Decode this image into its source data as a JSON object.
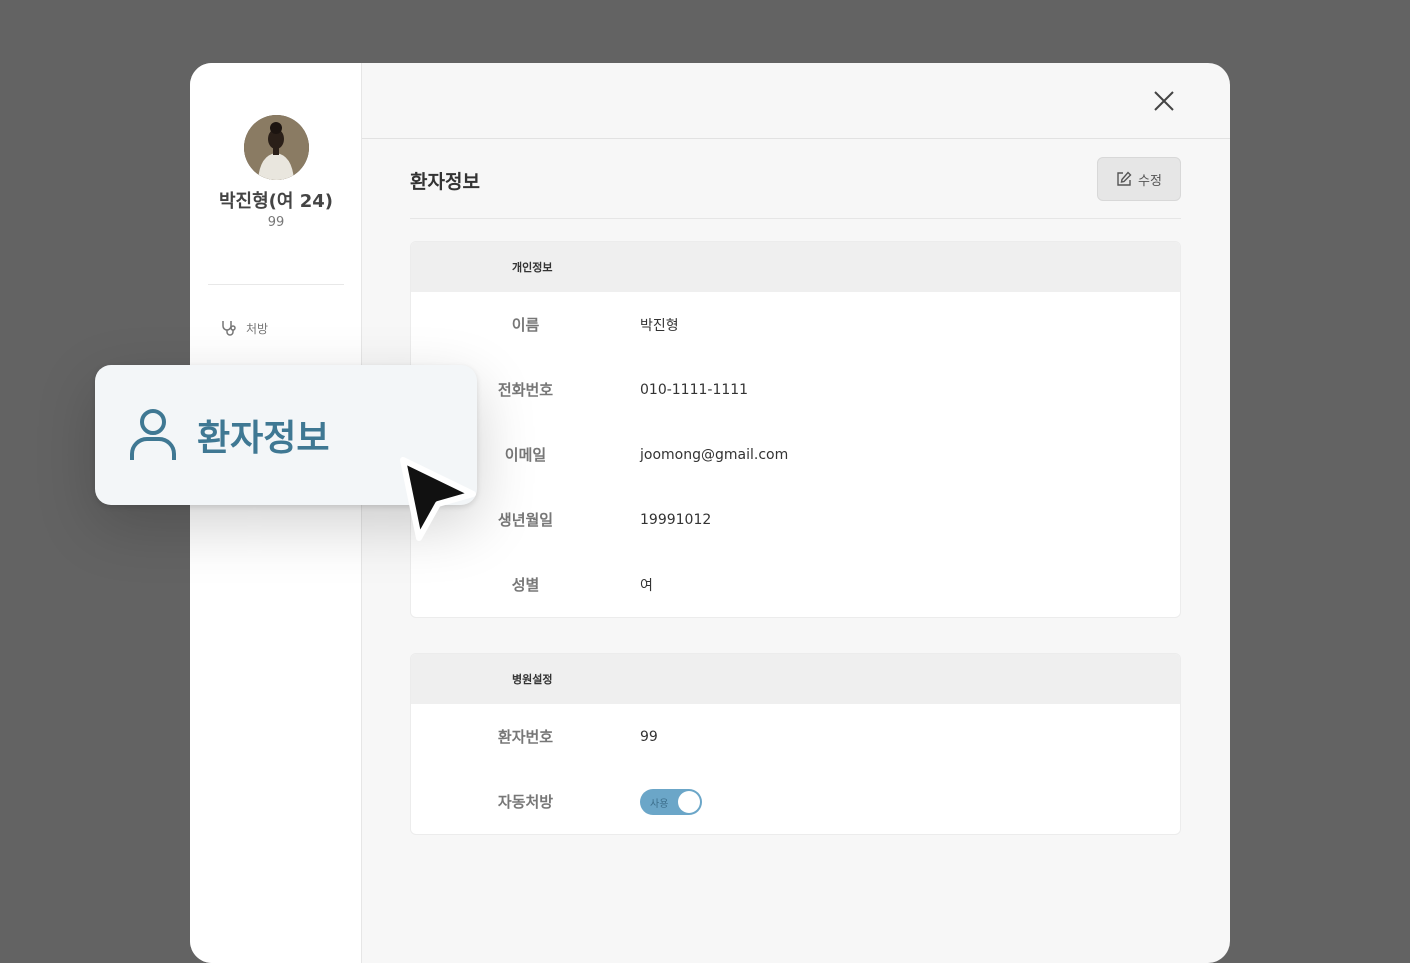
{
  "sidebar": {
    "patient_name": "박진형(여 24)",
    "patient_number": "99",
    "items": [
      {
        "label": "처방",
        "icon": "stethoscope-icon"
      }
    ]
  },
  "header": {
    "close_icon": "close-icon"
  },
  "main": {
    "title": "환자정보",
    "edit_label": "수정",
    "edit_icon": "edit-icon"
  },
  "personal_info": {
    "heading": "개인정보",
    "rows": [
      {
        "label": "이름",
        "value": "박진형"
      },
      {
        "label": "전화번호",
        "value": "010-1111-1111"
      },
      {
        "label": "이메일",
        "value": "joomong@gmail.com"
      },
      {
        "label": "생년월일",
        "value": "19991012"
      },
      {
        "label": "성별",
        "value": "여"
      }
    ]
  },
  "hospital_settings": {
    "heading": "병원설정",
    "patient_no_label": "환자번호",
    "patient_no_value": "99",
    "auto_rx_label": "자동처방",
    "auto_rx_toggle_text": "사용",
    "auto_rx_enabled": true
  },
  "callout": {
    "label": "환자정보",
    "icon": "user-icon"
  },
  "colors": {
    "accent": "#3f7893",
    "toggle_on": "#6ba6c8",
    "backdrop": "#636363"
  }
}
